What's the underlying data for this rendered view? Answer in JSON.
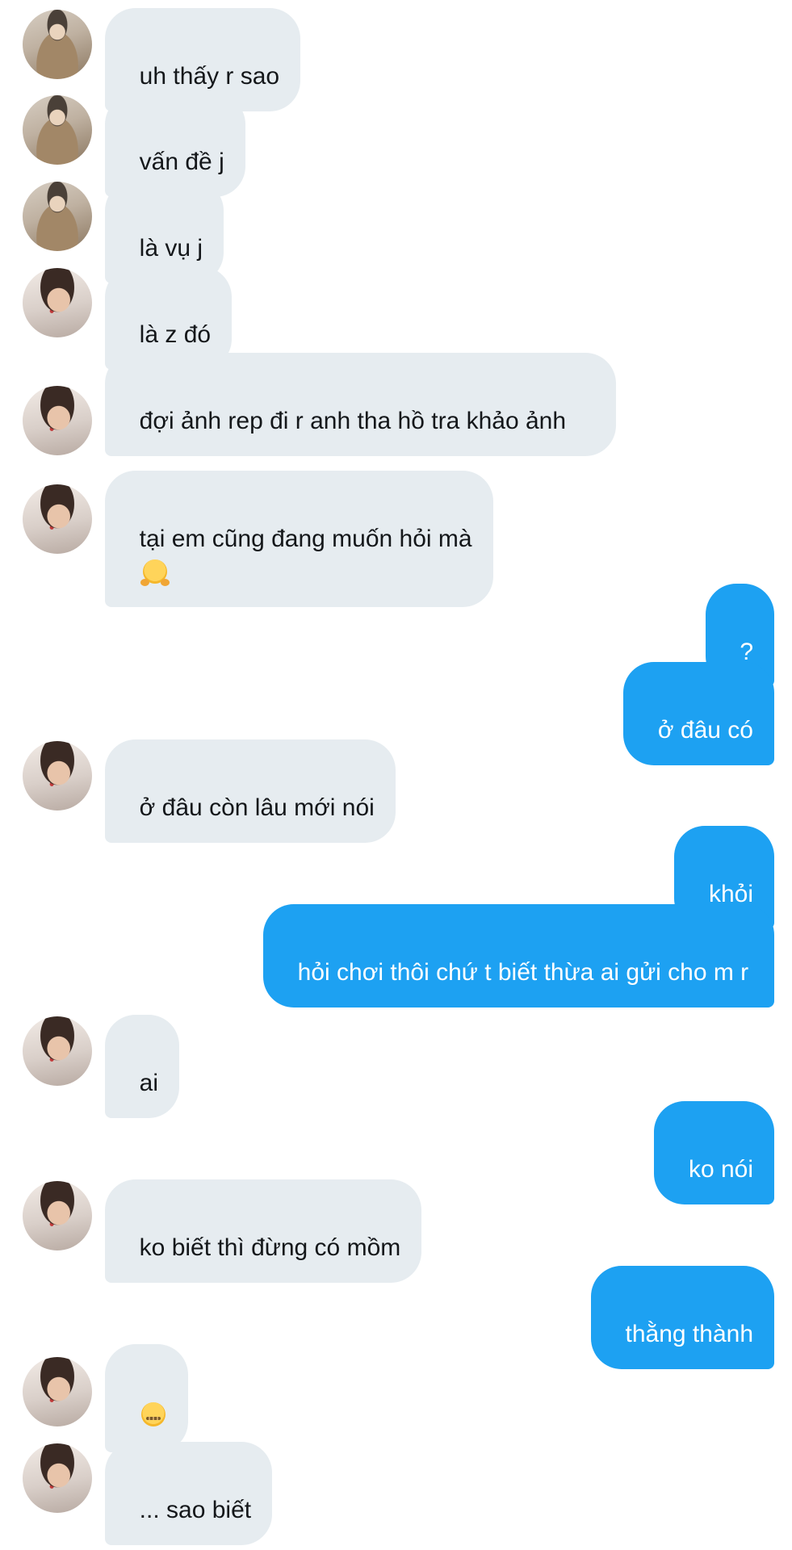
{
  "conversation": {
    "messages": [
      {
        "side": "in",
        "avatar": "a1",
        "text": "uh thấy r sao"
      },
      {
        "side": "in",
        "avatar": "a1",
        "text": "vấn đề j"
      },
      {
        "side": "in",
        "avatar": "a1",
        "text": "là vụ j"
      },
      {
        "side": "in",
        "avatar": "a2",
        "text": "là z đó"
      },
      {
        "side": "in",
        "avatar": "a2",
        "text": "đợi ảnh rep đi r anh tha hồ tra khảo ảnh"
      },
      {
        "side": "in",
        "avatar": "a2",
        "text": "tại em cũng đang muốn hỏi mà",
        "emoji": "smiling-face-with-open-hands-emoji"
      },
      {
        "side": "out",
        "text": "?"
      },
      {
        "side": "out",
        "text": "ở đâu có"
      },
      {
        "side": "in",
        "avatar": "a2",
        "text": "ở đâu còn lâu mới nói"
      },
      {
        "side": "out",
        "text": "khỏi"
      },
      {
        "side": "out",
        "text": "hỏi chơi thôi chứ t biết thừa ai gửi cho m r"
      },
      {
        "side": "in",
        "avatar": "a2",
        "text": "ai"
      },
      {
        "side": "out",
        "text": "ko nói"
      },
      {
        "side": "in",
        "avatar": "a2",
        "text": "ko biết thì đừng có mồm"
      },
      {
        "side": "out",
        "text": "thằng thành"
      },
      {
        "side": "in",
        "avatar": "a2",
        "text": "",
        "emoji": "zipper-mouth-face-emoji"
      },
      {
        "side": "in",
        "avatar": "a2",
        "text": "... sao biết"
      }
    ]
  },
  "colors": {
    "incoming_bubble": "#e6ecf0",
    "outgoing_bubble": "#1da1f2",
    "incoming_text": "#14171a",
    "outgoing_text": "#ffffff"
  }
}
